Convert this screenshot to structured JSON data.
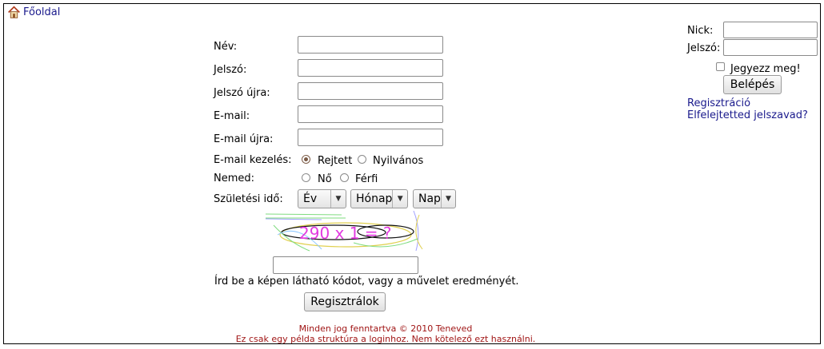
{
  "nav": {
    "home_label": "Főoldal"
  },
  "form": {
    "name_label": "Név:",
    "password_label": "Jelszó:",
    "password_again_label": "Jelszó újra:",
    "email_label": "E-mail:",
    "email_again_label": "E-mail újra:",
    "email_handling_label": "E-mail kezelés:",
    "email_hidden": "Rejtett",
    "email_public": "Nyilvános",
    "gender_label": "Nemed:",
    "gender_female": "Nő",
    "gender_male": "Férfi",
    "birth_label": "Születési idő:",
    "year_select": "Év",
    "month_select": "Hónap",
    "day_select": "Nap",
    "captcha_text": "290 x 1 = ?",
    "captcha_hint": "Írd be a képen látható kódot, vagy a művelet eredményét.",
    "register_button": "Regisztrálok"
  },
  "login": {
    "nick_label": "Nick:",
    "password_label": "Jelszó:",
    "remember_label": "Jegyezz meg!",
    "login_button": "Belépés",
    "register_link": "Regisztráció",
    "forgot_link": "Elfelejtetted jelszavad?"
  },
  "footer": {
    "copyright": "Minden jog fenntartva © 2010 Teneved",
    "note": "Ez csak egy példa struktúra a loginhoz. Nem kötelező ezt használni."
  },
  "colors": {
    "link": "#1a1a8c",
    "footer": "#a01515",
    "captcha": "#e23be0"
  }
}
